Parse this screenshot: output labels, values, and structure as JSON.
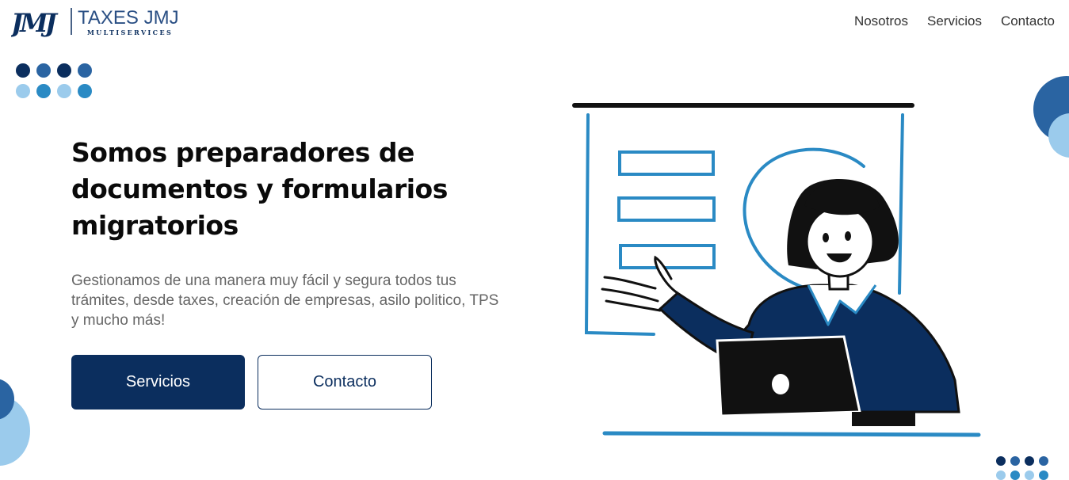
{
  "brand": {
    "monogram": "JMJ",
    "name": "TAXES JMJ",
    "tagline": "MULTISERVICES"
  },
  "nav": {
    "items": [
      "Nosotros",
      "Servicios",
      "Contacto"
    ]
  },
  "hero": {
    "title": "Somos preparadores de documentos y formularios migratorios",
    "description": "Gestionamos de una manera muy fácil y segura todos tus trámites, desde taxes, creación de empresas, asilo politico, TPS y mucho más!",
    "primary_button": "Servicios",
    "secondary_button": "Contacto"
  },
  "colors": {
    "navy": "#0b2e5e",
    "blue": "#2a64a2",
    "light_blue": "#9bcbec",
    "sky": "#2a8ac4"
  },
  "illustration": {
    "icon": "presenter-with-laptop-illustration"
  }
}
